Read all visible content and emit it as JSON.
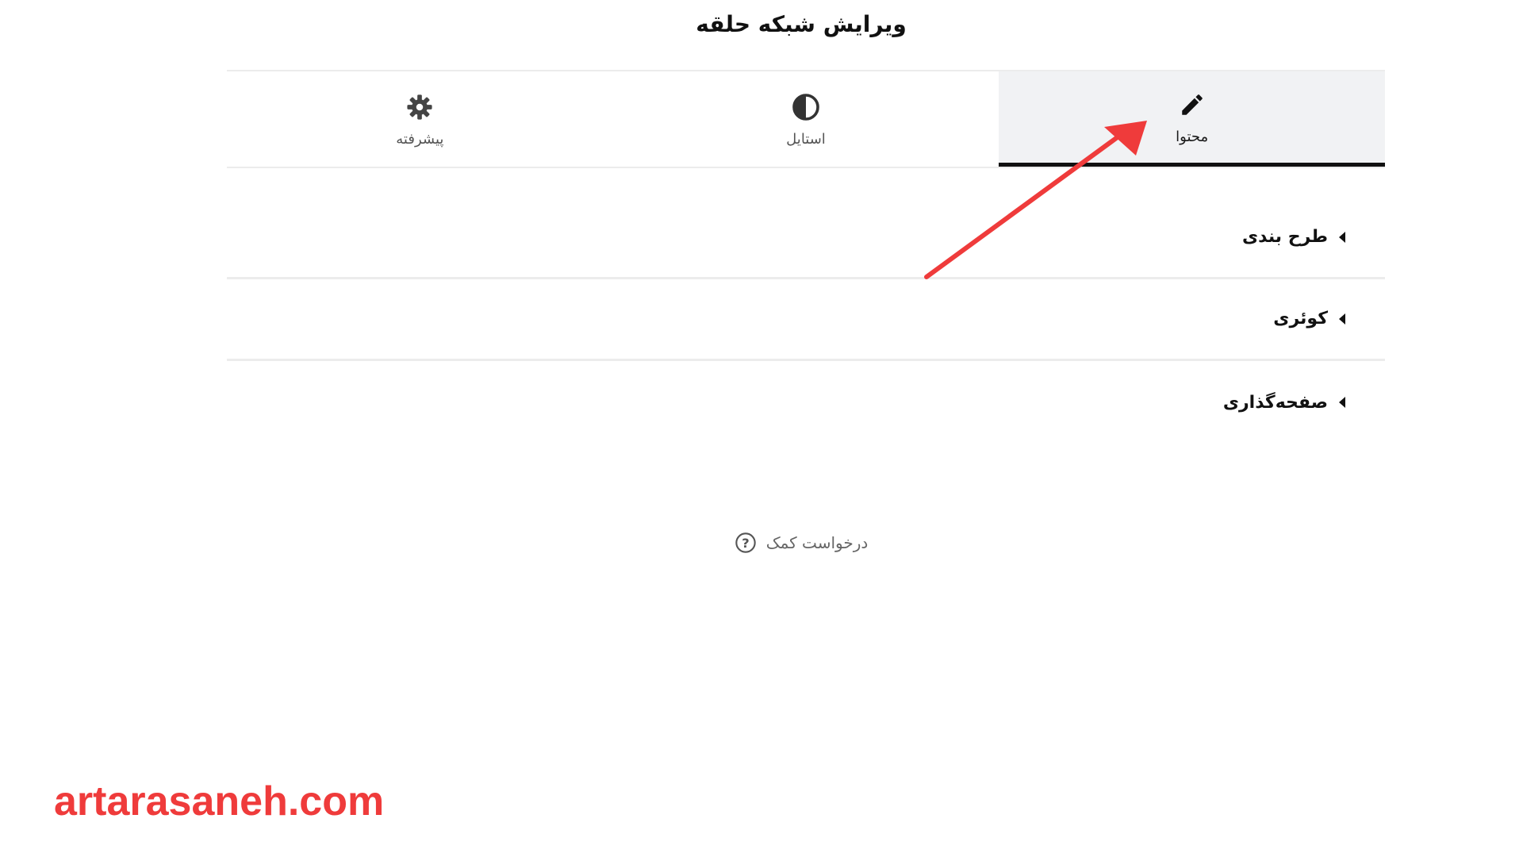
{
  "header": {
    "title": "ویرایش شبکه حلقه"
  },
  "tabs": [
    {
      "label": "محتوا",
      "icon": "pencil-icon",
      "active": true
    },
    {
      "label": "استایل",
      "icon": "half-circle-icon",
      "active": false
    },
    {
      "label": "پیشرفته",
      "icon": "gear-icon",
      "active": false
    }
  ],
  "sections": [
    {
      "label": "طرح بندی"
    },
    {
      "label": "کوئری"
    },
    {
      "label": "صفحه‌گذاری"
    }
  ],
  "help": {
    "label": "درخواست کمک",
    "icon": "question-circle-icon"
  },
  "watermark": {
    "text": "artarasaneh.com",
    "color": "#ef3b3b"
  },
  "annotation": {
    "color": "#ef3b3b"
  }
}
